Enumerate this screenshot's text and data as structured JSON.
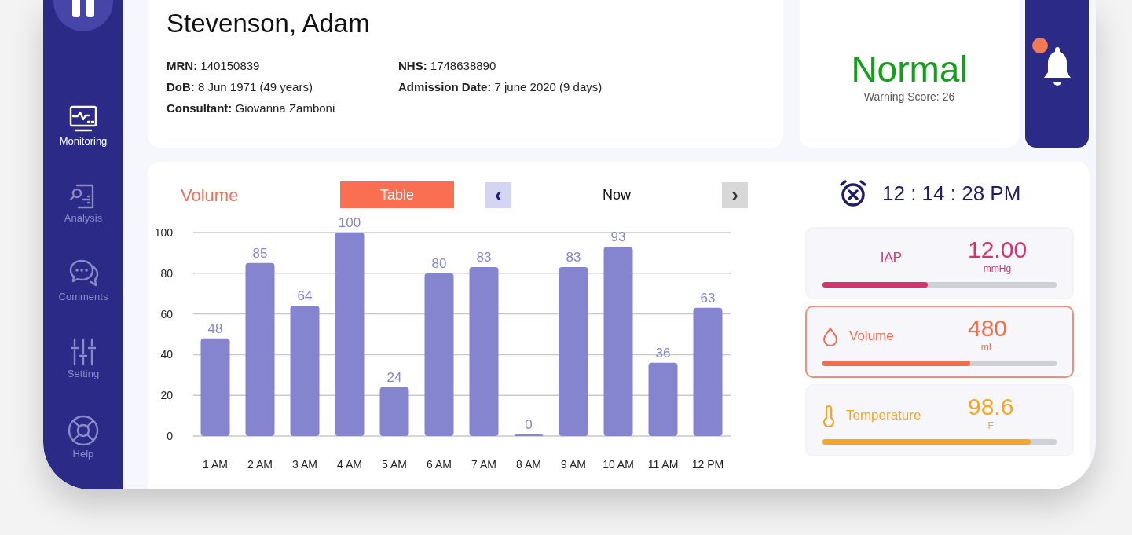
{
  "sidebar": {
    "items": [
      {
        "label": "Monitoring",
        "kind": "monitor",
        "selected": true
      },
      {
        "label": "Analysis",
        "kind": "analysis",
        "selected": false
      },
      {
        "label": "Comments",
        "kind": "comments",
        "selected": false
      },
      {
        "label": "Setting",
        "kind": "setting",
        "selected": false
      },
      {
        "label": "Help",
        "kind": "help",
        "selected": false
      }
    ]
  },
  "patient": {
    "name": "Stevenson, Adam",
    "fields": [
      {
        "label": "MRN:",
        "value": "140150839"
      },
      {
        "label": "NHS:",
        "value": "1748638890"
      },
      {
        "label": "DoB:",
        "value": "8 Jun 1971 (49 years)"
      },
      {
        "label": "Admission Date:",
        "value": "7 june 2020 (9 days)"
      },
      {
        "label": "Consultant:",
        "value": "Giovanna Zamboni"
      }
    ]
  },
  "status": {
    "label": "Normal",
    "score": "Warning Score: 26",
    "color": "#12a019"
  },
  "notifications": {
    "unread": true
  },
  "chart_panel": {
    "title": "Volume",
    "view_button": "Table",
    "prev": "‹",
    "period": "Now",
    "next": "›",
    "chart_data": {
      "type": "bar",
      "categories": [
        "1 AM",
        "2 AM",
        "3 AM",
        "4 AM",
        "5 AM",
        "6 AM",
        "7 AM",
        "8 AM",
        "9 AM",
        "10 AM",
        "11 AM",
        "12 PM"
      ],
      "series": [
        {
          "color": "#8585cf",
          "values": [
            48,
            85,
            64,
            100,
            24,
            80,
            83,
            0,
            83,
            93,
            36,
            63
          ]
        }
      ],
      "ylim": [
        0,
        100
      ],
      "yticks": [
        0,
        20,
        40,
        60,
        80,
        100
      ],
      "grid": true,
      "data_labels": true
    }
  },
  "clock": {
    "time": "12 : 14 : 28 PM"
  },
  "vitals": [
    {
      "kind": "iap",
      "label": "IAP",
      "value": "12.00",
      "unit": "mmHg",
      "level": 0.45,
      "color": "#d6336c",
      "selected": false
    },
    {
      "kind": "volume",
      "label": "Volume",
      "value": "480",
      "unit": "mL",
      "level": 0.63,
      "color": "#f46d4f",
      "selected": true
    },
    {
      "kind": "temperature",
      "label": "Temperature",
      "value": "98.6",
      "unit": "F",
      "level": 0.89,
      "color": "#f5a623",
      "selected": false
    }
  ]
}
